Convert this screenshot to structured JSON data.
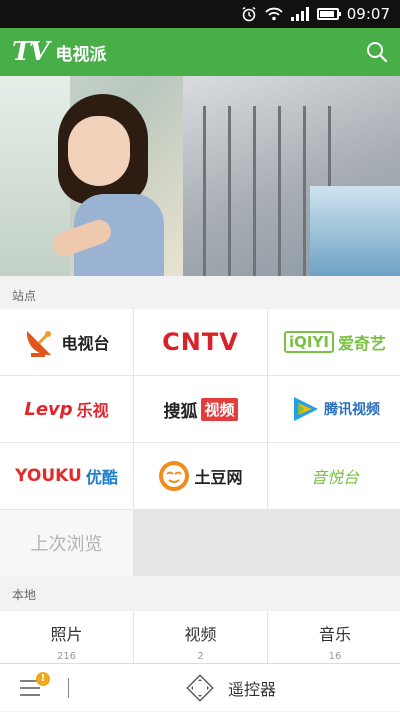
{
  "status_bar": {
    "time": "09:07",
    "icons": [
      "alarm-icon",
      "wifi-icon",
      "signal-icon",
      "battery-icon"
    ]
  },
  "app_bar": {
    "logo_text": "TV",
    "title": "电视派",
    "search_icon": "search-icon",
    "background": "#48ae48"
  },
  "sections": {
    "sites_label": "站点",
    "local_label": "本地"
  },
  "sites": [
    {
      "label": "电视台",
      "icon": "satellite-dish-icon"
    },
    {
      "label": "CNTV",
      "icon": "cntv-logo"
    },
    {
      "label": "爱奇艺",
      "logo_text": "iQIYI",
      "icon": "iqiyi-logo"
    },
    {
      "label": "乐视",
      "logo_text": "Levp",
      "icon": "letv-logo"
    },
    {
      "label": "搜狐",
      "label2": "视频",
      "icon": "sohu-logo"
    },
    {
      "label": "腾讯视频",
      "icon": "tencent-video-logo"
    },
    {
      "label": "优酷",
      "logo_text": "YOUKU",
      "icon": "youku-logo"
    },
    {
      "label": "土豆网",
      "icon": "tudou-logo"
    },
    {
      "label": "音悦台",
      "icon": "yinyuetai-logo"
    }
  ],
  "last_browse": {
    "label": "上次浏览"
  },
  "local_items": [
    {
      "name": "照片",
      "count": "216"
    },
    {
      "name": "视频",
      "count": "2"
    },
    {
      "name": "音乐",
      "count": "16"
    }
  ],
  "bottom_bar": {
    "menu_icon": "menu-icon",
    "badge": "!",
    "remote_icon": "dpad-icon",
    "remote_label": "遥控器"
  }
}
